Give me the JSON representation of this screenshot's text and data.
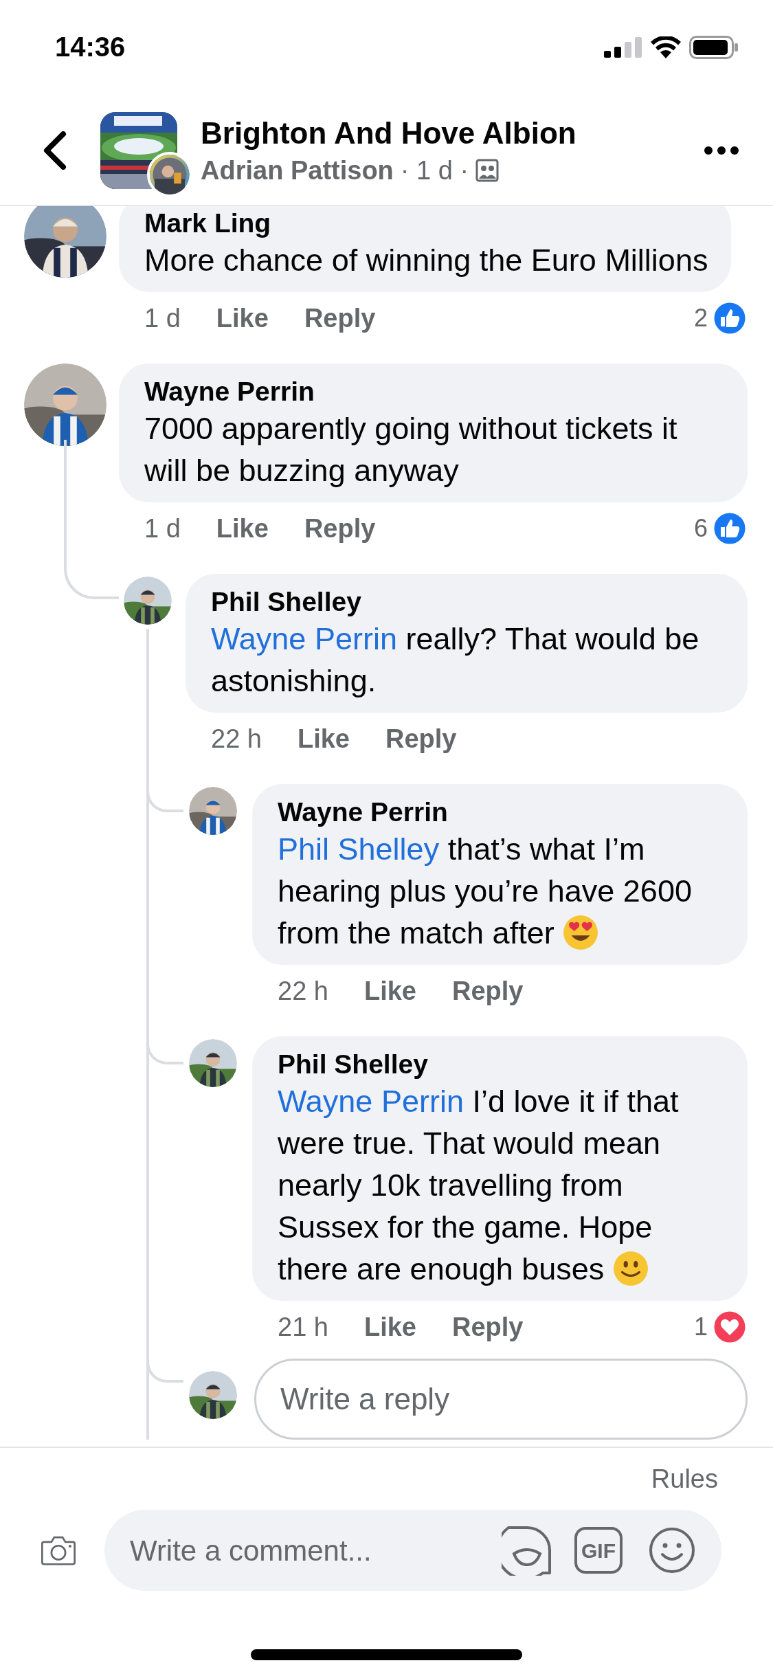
{
  "status_bar": {
    "time": "14:36"
  },
  "header": {
    "title": "Brighton And Hove Albion",
    "author": "Adrian Pattison",
    "meta": "· 1 d ·"
  },
  "comments": [
    {
      "author": "Mark Ling",
      "text": "More chance of winning the Euro Millions",
      "time": "1 d",
      "actions": [
        "Like",
        "Reply"
      ],
      "reaction": {
        "kind": "like",
        "count": "2"
      }
    },
    {
      "author": "Wayne Perrin",
      "text": "7000 apparently going without tickets it will be buzzing anyway",
      "time": "1 d",
      "actions": [
        "Like",
        "Reply"
      ],
      "reaction": {
        "kind": "like",
        "count": "6"
      },
      "children": [
        {
          "author": "Phil Shelley",
          "mention": "Wayne Perrin",
          "text": "really? That would be astonishing.",
          "time": "22 h",
          "actions": [
            "Like",
            "Reply"
          ],
          "children": [
            {
              "author": "Wayne Perrin",
              "mention": "Phil Shelley",
              "text": "that’s what I’m hearing plus you’re have 2600 from the match after",
              "emoji": {
                "kind": "heart_eyes"
              },
              "time": "22 h",
              "actions": [
                "Like",
                "Reply"
              ]
            },
            {
              "author": "Phil Shelley",
              "mention": "Wayne Perrin",
              "text": "I’d love it if that were true. That would mean nearly 10k travelling from Sussex for the game. Hope there are enough buses",
              "emoji": {
                "kind": "smile"
              },
              "time": "21 h",
              "actions": [
                "Like",
                "Reply"
              ],
              "reaction": {
                "kind": "love",
                "count": "1"
              }
            }
          ],
          "reply_field": {
            "placeholder": "Write a reply"
          }
        }
      ]
    }
  ],
  "composer": {
    "rules": "Rules",
    "placeholder": "Write a comment...",
    "gif_label": "GIF"
  }
}
